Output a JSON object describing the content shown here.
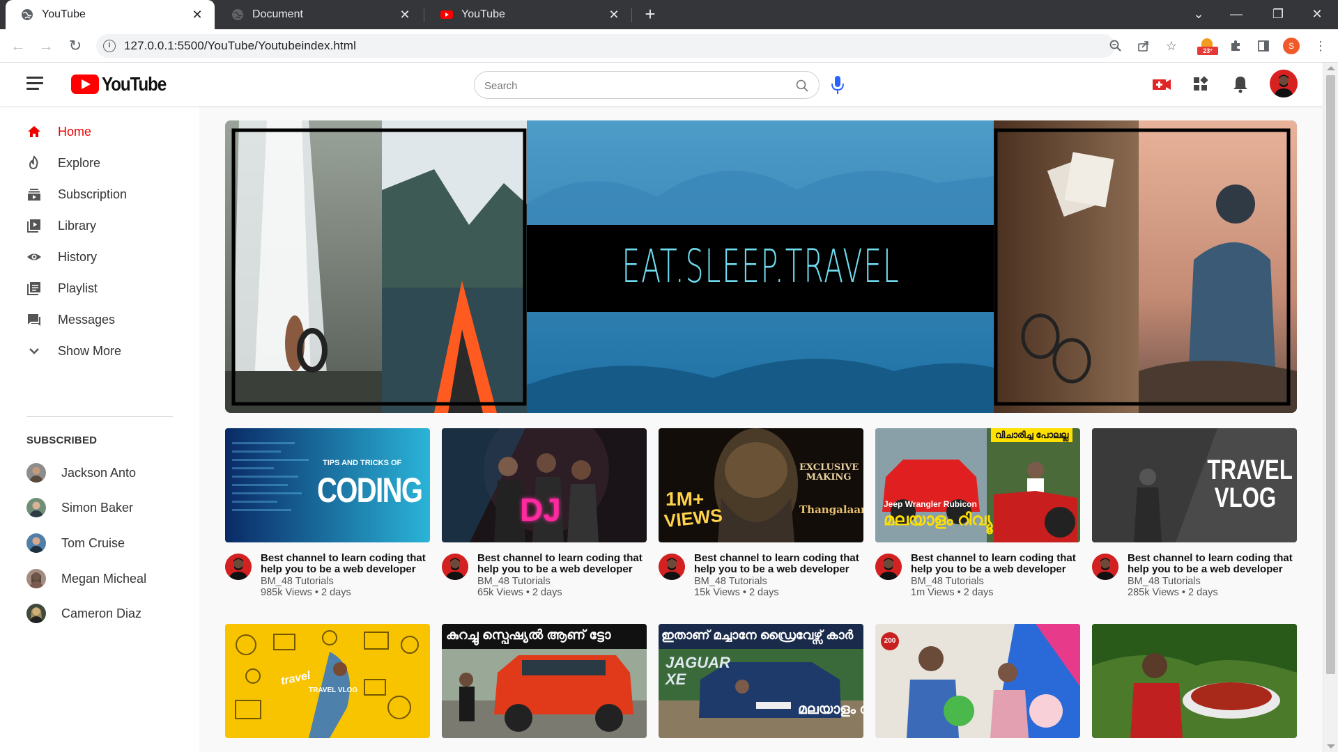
{
  "browser": {
    "tabs": [
      {
        "title": "YouTube",
        "active": true
      },
      {
        "title": "Document",
        "active": false
      },
      {
        "title": "YouTube",
        "active": false
      }
    ],
    "url": "127.0.0.1:5500/YouTube/Youtubeindex.html",
    "extension_badge": "23°",
    "profile_initial": "S"
  },
  "header": {
    "logo_text": "YouTube",
    "search_placeholder": "Search"
  },
  "sidebar": {
    "items": [
      {
        "label": "Home",
        "icon": "home-icon",
        "active": true
      },
      {
        "label": "Explore",
        "icon": "explore-icon"
      },
      {
        "label": "Subscription",
        "icon": "subscription-icon"
      },
      {
        "label": "Library",
        "icon": "library-icon"
      },
      {
        "label": "History",
        "icon": "history-icon"
      },
      {
        "label": "Playlist",
        "icon": "playlist-icon"
      },
      {
        "label": "Messages",
        "icon": "messages-icon"
      },
      {
        "label": "Show More",
        "icon": "chevron-down-icon"
      }
    ],
    "subscribed_title": "SUBSCRIBED",
    "subscribed": [
      {
        "name": "Jackson Anto"
      },
      {
        "name": "Simon Baker"
      },
      {
        "name": "Tom Cruise"
      },
      {
        "name": "Megan Micheal"
      },
      {
        "name": "Cameron Diaz"
      }
    ]
  },
  "banner": {
    "text": "EAT.SLEEP.TRAVEL"
  },
  "videos": [
    {
      "title": "Best channel to learn coding that help you to be a web developer",
      "channel": "BM_48 Tutorials",
      "meta": "985k Views • 2 days",
      "thumb_text_1": "TIPS AND TRICKS OF",
      "thumb_text_2": "CODING"
    },
    {
      "title": "Best channel to learn coding that help you to be a web developer",
      "channel": "BM_48 Tutorials",
      "meta": "65k Views • 2 days",
      "thumb_text_1": "DJ"
    },
    {
      "title": "Best channel to learn coding that help you to be a web developer",
      "channel": "BM_48 Tutorials",
      "meta": "15k Views • 2 days",
      "thumb_text_1": "1M+",
      "thumb_text_2": "VIEWS",
      "thumb_text_3": "EXCLUSIVE MAKING",
      "thumb_text_4": "Thangalaan"
    },
    {
      "title": "Best channel to learn coding that help you to be a web developer",
      "channel": "BM_48 Tutorials",
      "meta": "1m Views • 2 days",
      "thumb_text_1": "വിചാരിച്ച പോലല്ല",
      "thumb_text_2": "Jeep Wrangler Rubicon",
      "thumb_text_3": "മലയാളം റിവ്യൂ"
    },
    {
      "title": "Best channel to learn coding that help you to be a web developer",
      "channel": "BM_48 Tutorials",
      "meta": "285k Views • 2 days",
      "thumb_text_1": "TRAVEL",
      "thumb_text_2": "VLOG"
    },
    {
      "thumb_text_1": "travel",
      "thumb_text_2": "TRAVEL VLOG"
    },
    {
      "thumb_text_1": "കുറച്ചു സ്പെഷ്യൽ ആണ് ട്ടോ"
    },
    {
      "thumb_text_1": "ഇതാണ് മച്ചാനേ ഡ്രൈവേഴ്സ് കാർ",
      "thumb_text_2": "JAGUAR XE",
      "thumb_text_3": "മലയാളം റിവ്യൂ"
    },
    {
      "thumb_text_1": "200"
    },
    {}
  ],
  "colors": {
    "brand_red": "#ff0000",
    "active_red": "#ee0000",
    "banner_text": "#6fdcf0"
  }
}
